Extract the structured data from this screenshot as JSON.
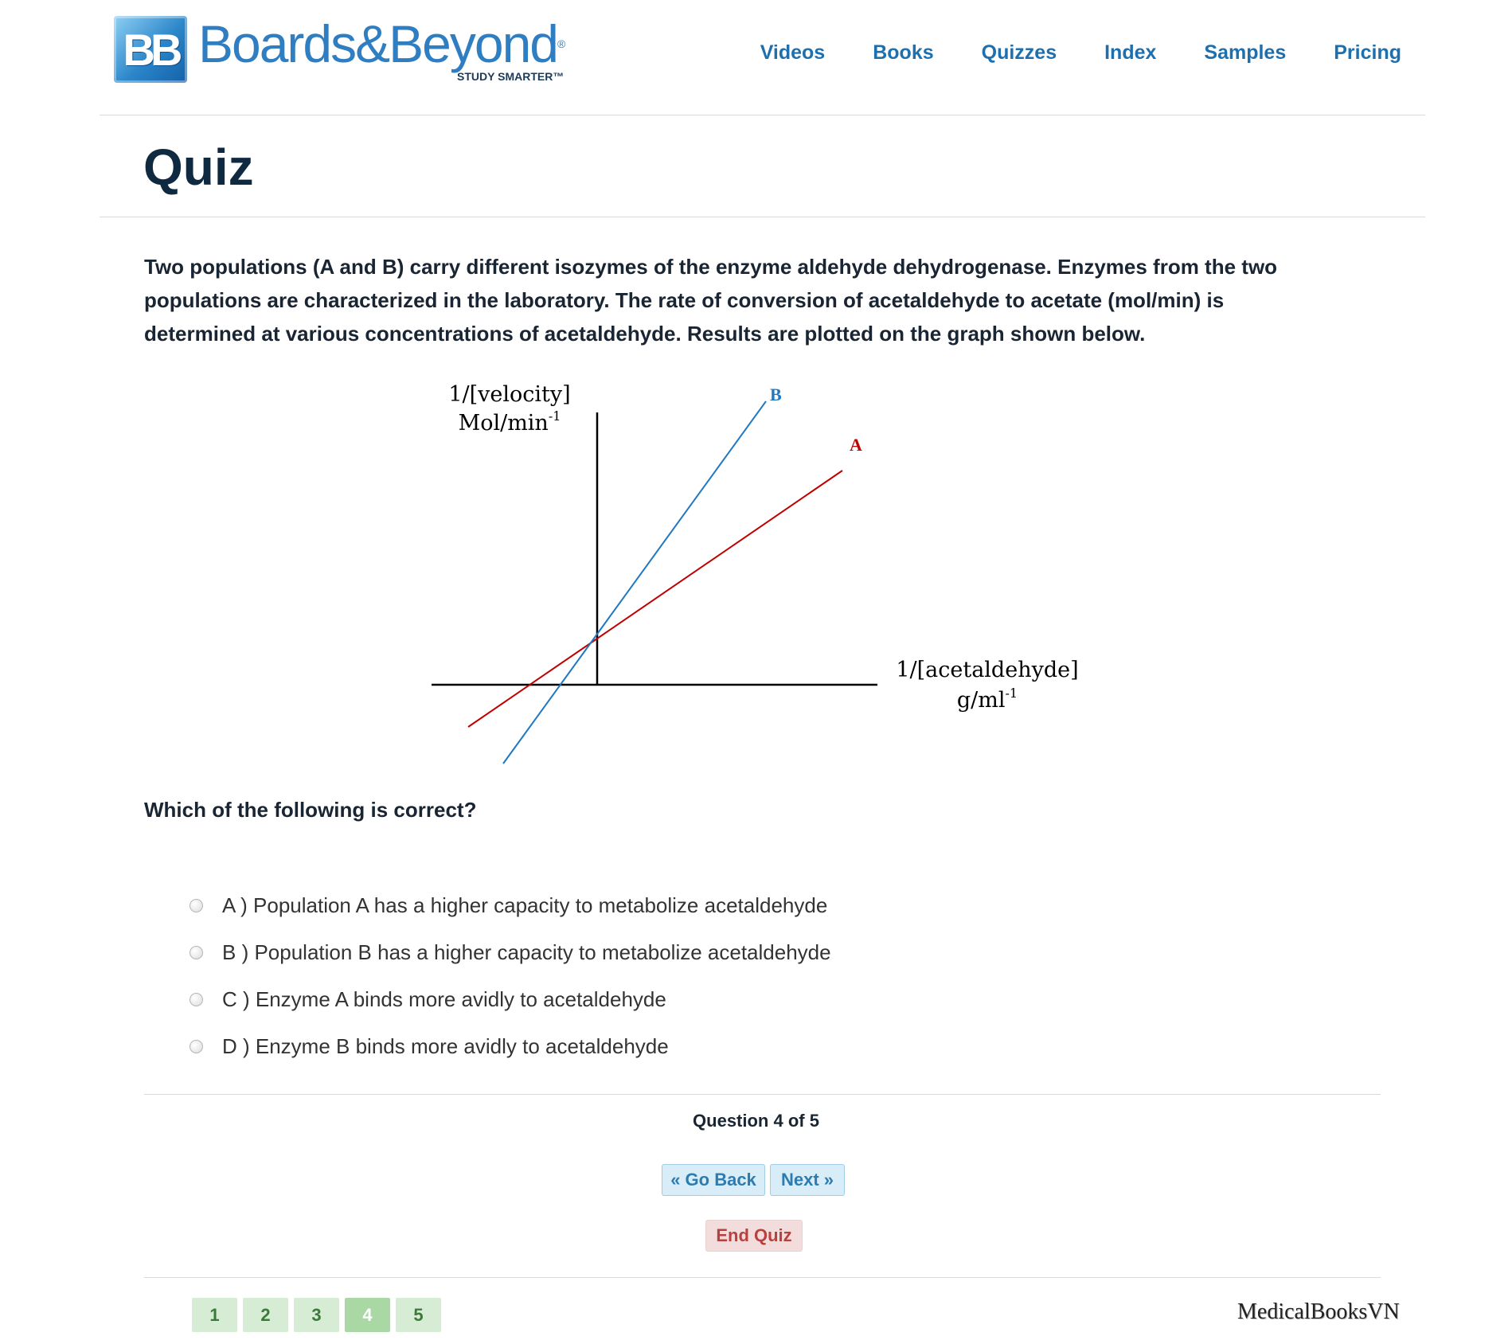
{
  "header": {
    "logo": {
      "badge": "BB",
      "name": "Boards&Beyond",
      "registered": "®",
      "tagline": "STUDY SMARTER™"
    },
    "nav": [
      "Videos",
      "Books",
      "Quizzes",
      "Index",
      "Samples",
      "Pricing"
    ]
  },
  "page": {
    "title": "Quiz"
  },
  "question": {
    "stem": "Two populations (A and B) carry different isozymes of the enzyme aldehyde dehydrogenase. Enzymes from the two populations are characterized in the laboratory. The rate of conversion of acetaldehyde to acetate (mol/min) is determined at various concentrations of acetaldehyde. Results are plotted on the graph shown below.",
    "prompt": "Which of the following is correct?",
    "options": [
      "A ) Population A has a higher capacity to metabolize acetaldehyde",
      "B ) Population B has a higher capacity to metabolize acetaldehyde",
      "C ) Enzyme A binds more avidly to acetaldehyde",
      "D ) Enzyme B binds more avidly to acetaldehyde"
    ]
  },
  "graph": {
    "y_label_line1": "1/[velocity]",
    "y_label_line2": "Mol/min",
    "y_label_sup": "-1",
    "x_label_line1": "1/[acetaldehyde]",
    "x_label_line2": "g/ml",
    "x_label_sup": "-1",
    "line_a_label": "A",
    "line_b_label": "B",
    "line_a_color": "#c00000",
    "line_b_color": "#1f78c1"
  },
  "progress": {
    "text": "Question 4 of 5"
  },
  "controls": {
    "back": "« Go Back",
    "next": "Next »",
    "end": "End Quiz"
  },
  "pager": {
    "pages": [
      "1",
      "2",
      "3",
      "4",
      "5"
    ],
    "current": "4"
  },
  "watermark": "MedicalBooksVN"
}
